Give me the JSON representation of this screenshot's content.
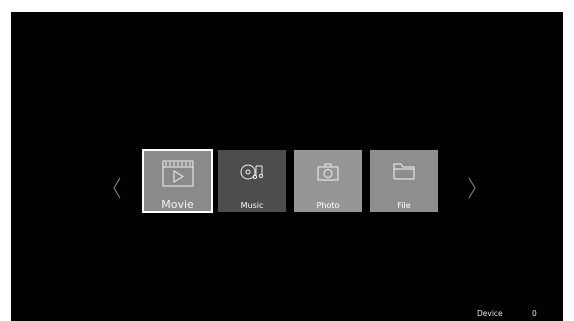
{
  "nav": {
    "prev_icon": "chevron-left-icon",
    "next_icon": "chevron-right-icon"
  },
  "tiles": [
    {
      "label": "Movie",
      "icon": "movie-clapboard-icon",
      "selected": true
    },
    {
      "label": "Music",
      "icon": "music-disc-icon",
      "selected": false
    },
    {
      "label": "Photo",
      "icon": "camera-icon",
      "selected": false
    },
    {
      "label": "File",
      "icon": "folder-icon",
      "selected": false
    }
  ],
  "footer": {
    "device_label": "Device",
    "device_count": "0"
  },
  "colors": {
    "background": "#000000",
    "selected_border": "#ffffff",
    "movie_tile": "#8a8a8a",
    "music_tile": "#4d4d4d",
    "photo_tile": "#969696",
    "file_tile": "#8e8e8e"
  }
}
